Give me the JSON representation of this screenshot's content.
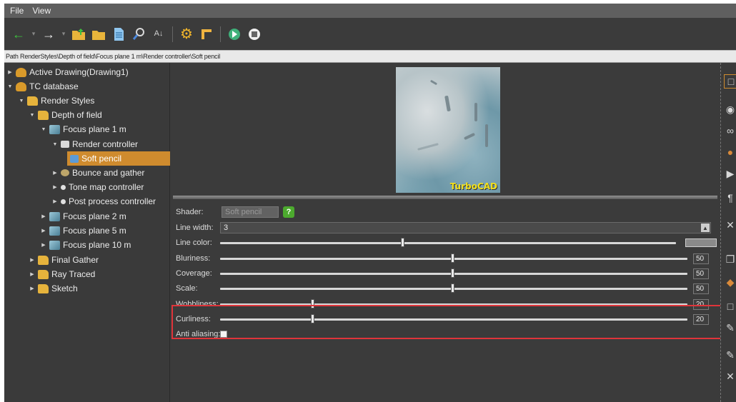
{
  "menu": [
    "File",
    "View"
  ],
  "toolbar": {
    "icons": [
      "back-arrow",
      "forward-arrow",
      "open-folder",
      "folder",
      "document",
      "search",
      "sort",
      "gear",
      "frame",
      "play",
      "stop"
    ]
  },
  "path": "Path RenderStyles\\Depth of field\\Focus plane 1 m\\Render controller\\Soft pencil",
  "tree": {
    "items": [
      {
        "label": "Active Drawing(Drawing1)"
      },
      {
        "label": "TC database"
      },
      {
        "label": "Render Styles"
      },
      {
        "label": "Depth of field"
      },
      {
        "label": "Focus plane 1 m"
      },
      {
        "label": "Render controller"
      },
      {
        "label": "Soft pencil"
      },
      {
        "label": "Bounce and gather"
      },
      {
        "label": "Tone map controller"
      },
      {
        "label": "Post process controller"
      },
      {
        "label": "Focus plane 2 m"
      },
      {
        "label": "Focus plane 5 m"
      },
      {
        "label": "Focus plane 10 m"
      },
      {
        "label": "Final Gather"
      },
      {
        "label": "Ray Traced"
      },
      {
        "label": "Sketch"
      }
    ]
  },
  "preview": {
    "label": "TurboCAD"
  },
  "props": {
    "shader": {
      "label": "Shader:",
      "value": "Soft pencil",
      "help": "?"
    },
    "line_width": {
      "label": "Line width:",
      "value": "3"
    },
    "line_color": {
      "label": "Line color:",
      "level": 0.5
    },
    "bluriness": {
      "label": "Bluriness:",
      "value": "50"
    },
    "coverage": {
      "label": "Coverage:",
      "value": "50"
    },
    "scale": {
      "label": "Scale:",
      "value": "50"
    },
    "wobbliness": {
      "label": "Wobbliness:",
      "value": "20"
    },
    "curliness": {
      "label": "Curliness:",
      "value": "20"
    },
    "anti_aliasing": {
      "label": "Anti aliasing:",
      "checked": true
    }
  },
  "colors": {
    "selection": "#cf8b2e",
    "highlight": "#e0343a",
    "help": "#4caa2e",
    "preview_text": "#f2e11d"
  }
}
